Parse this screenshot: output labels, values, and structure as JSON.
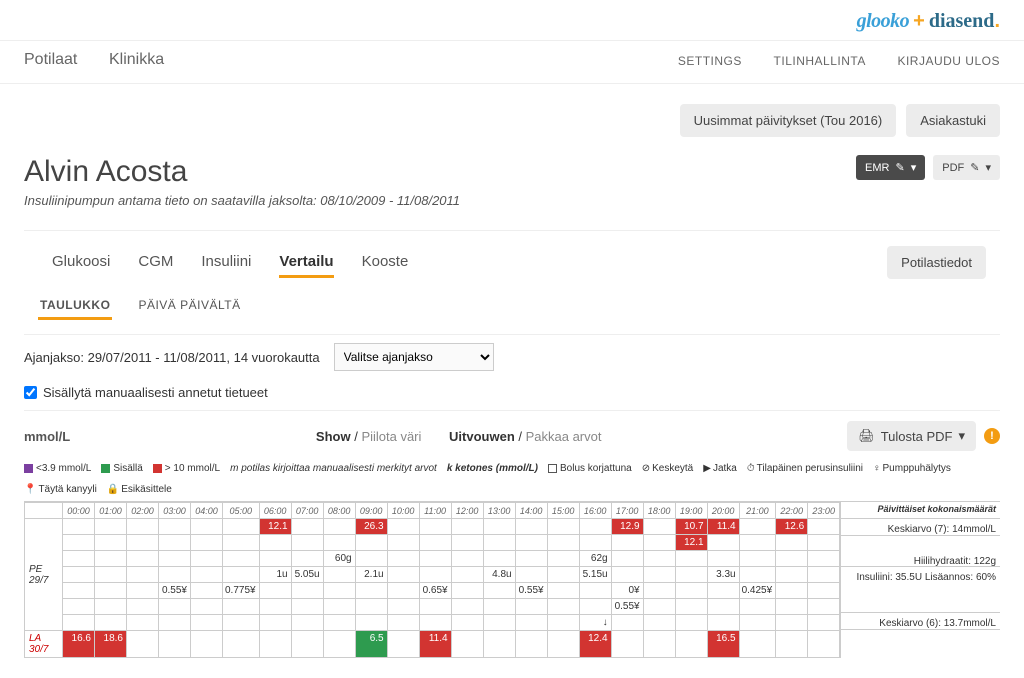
{
  "brand": {
    "glooko": "glooko",
    "plus": "+",
    "diasend": "diasend",
    "dot": "."
  },
  "nav": {
    "left": {
      "patients": "Potilaat",
      "clinic": "Klinikka"
    },
    "right": {
      "settings": "SETTINGS",
      "account": "TILINHALLINTA",
      "logout": "KIRJAUDU ULOS"
    }
  },
  "buttons": {
    "latest_updates": "Uusimmat päivitykset (Tou 2016)",
    "support": "Asiakastuki",
    "emr": "EMR",
    "pdf": "PDF",
    "patient_info": "Potilastiedot",
    "print_pdf": "Tulosta PDF"
  },
  "patient": {
    "name": "Alvin Acosta",
    "subtitle": "Insuliinipumpun antama tieto on saatavilla jaksolta: 08/10/2009 - 11/08/2011"
  },
  "tabs": {
    "glucose": "Glukoosi",
    "cgm": "CGM",
    "insulin": "Insuliini",
    "compare": "Vertailu",
    "summary": "Kooste"
  },
  "subtabs": {
    "table": "TAULUKKO",
    "daybyday": "PÄIVÄ PÄIVÄLTÄ"
  },
  "controls": {
    "range_label": "Ajanjakso: 29/07/2011 - 11/08/2011, 14 vuorokautta",
    "select_placeholder": "Valitse ajanjakso",
    "checkbox_label": "Sisällytä manuaalisesti annetut tietueet"
  },
  "toolstrip": {
    "unit": "mmol/L",
    "show": "Show",
    "hide_color": "Piilota väri",
    "expand": "Uitvouwen",
    "pack": "Pakkaa arvot"
  },
  "legend": {
    "low": "<3.9 mmol/L",
    "in": "Sisällä",
    "high": "> 10 mmol/L",
    "manual": "m potilas kirjoittaa manuaalisesti merkityt arvot",
    "ketones": "k ketones (mmol/L)",
    "bolus_corr": "Bolus korjattuna",
    "pause": "Keskeytä",
    "resume": "Jatka",
    "temp_basal": "Tilapäinen perusinsuliini",
    "alarm": "Pumppuhälytys",
    "fill": "Täytä kanyyli",
    "pretreat": "Esikäsittele"
  },
  "grid": {
    "hours": [
      "00:00",
      "01:00",
      "02:00",
      "03:00",
      "04:00",
      "05:00",
      "06:00",
      "07:00",
      "08:00",
      "09:00",
      "10:00",
      "11:00",
      "12:00",
      "13:00",
      "14:00",
      "15:00",
      "16:00",
      "17:00",
      "18:00",
      "19:00",
      "20:00",
      "21:00",
      "22:00",
      "23:00"
    ],
    "summary_header": "Päivittäiset kokonaismäärät",
    "day1": {
      "label": "PE 29/7",
      "r1": {
        "06:00": "12.1",
        "09:00": "26.3",
        "17:00": "12.9",
        "19:00": "10.7",
        "20:00": "11.4",
        "22:00": "12.6"
      },
      "r2": {
        "19:00": "12.1"
      },
      "r3": {
        "08:00": "60g",
        "16:00": "62g"
      },
      "r4": {
        "06:00": "1u",
        "07:00": "5.05u",
        "09:00": "2.1u",
        "13:00": "4.8u",
        "16:00": "5.15u",
        "20:00": "3.3u"
      },
      "r5": {
        "03:00": "0.55¥",
        "05:00": "0.775¥",
        "11:00": "0.65¥",
        "14:00": "0.55¥",
        "17:00": "0¥",
        "21:00": "0.425¥"
      },
      "r6": {
        "17:00": "0.55¥"
      },
      "r7": {
        "16:00": "↓"
      },
      "summary": {
        "avg": "Keskiarvo (7): 14mmol/L",
        "carbs": "Hiilihydraatit: 122g",
        "insulin": "Insuliini: 35.5U Lisäannos: 60%"
      }
    },
    "day2": {
      "label": "LA 30/7",
      "r1": {
        "00:00": "16.6",
        "01:00": "18.6",
        "09:00": "6.5",
        "11:00": "11.4",
        "16:00": "12.4",
        "20:00": "16.5"
      },
      "summary": {
        "avg": "Keskiarvo (6): 13.7mmol/L"
      }
    }
  },
  "chart_data": {
    "type": "table",
    "unit": "mmol/L",
    "date_range": "29/07/2011 - 11/08/2011",
    "days": 14,
    "hours": [
      "00:00",
      "01:00",
      "02:00",
      "03:00",
      "04:00",
      "05:00",
      "06:00",
      "07:00",
      "08:00",
      "09:00",
      "10:00",
      "11:00",
      "12:00",
      "13:00",
      "14:00",
      "15:00",
      "16:00",
      "17:00",
      "18:00",
      "19:00",
      "20:00",
      "21:00",
      "22:00",
      "23:00"
    ],
    "rows": [
      {
        "day": "PE 29/7",
        "glucose": [
          null,
          null,
          null,
          null,
          null,
          null,
          12.1,
          null,
          null,
          26.3,
          null,
          null,
          null,
          null,
          null,
          null,
          null,
          12.9,
          null,
          10.7,
          11.4,
          null,
          12.6,
          null
        ],
        "glucose2": [
          null,
          null,
          null,
          null,
          null,
          null,
          null,
          null,
          null,
          null,
          null,
          null,
          null,
          null,
          null,
          null,
          null,
          null,
          null,
          12.1,
          null,
          null,
          null,
          null
        ],
        "carbs_g": [
          null,
          null,
          null,
          null,
          null,
          null,
          null,
          null,
          60,
          null,
          null,
          null,
          null,
          null,
          null,
          null,
          62,
          null,
          null,
          null,
          null,
          null,
          null,
          null
        ],
        "bolus_u": [
          null,
          null,
          null,
          null,
          null,
          null,
          1,
          5.05,
          null,
          2.1,
          null,
          null,
          null,
          4.8,
          null,
          null,
          5.15,
          null,
          null,
          null,
          3.3,
          null,
          null,
          null
        ],
        "basal1": [
          null,
          null,
          null,
          0.55,
          null,
          0.775,
          null,
          null,
          null,
          null,
          null,
          0.65,
          null,
          null,
          0.55,
          null,
          null,
          0,
          null,
          null,
          null,
          0.425,
          null,
          null
        ],
        "basal2": [
          null,
          null,
          null,
          null,
          null,
          null,
          null,
          null,
          null,
          null,
          null,
          null,
          null,
          null,
          null,
          null,
          null,
          0.55,
          null,
          null,
          null,
          null,
          null,
          null
        ],
        "summary": {
          "avg_n": 7,
          "avg_mmolL": 14,
          "carbs_g": 122,
          "insulin_U": 35.5,
          "bolus_pct": 60
        }
      },
      {
        "day": "LA 30/7",
        "glucose": [
          16.6,
          18.6,
          null,
          null,
          null,
          null,
          null,
          null,
          null,
          6.5,
          null,
          11.4,
          null,
          null,
          null,
          null,
          12.4,
          null,
          null,
          null,
          16.5,
          null,
          null,
          null
        ],
        "summary": {
          "avg_n": 6,
          "avg_mmolL": 13.7
        }
      }
    ]
  }
}
